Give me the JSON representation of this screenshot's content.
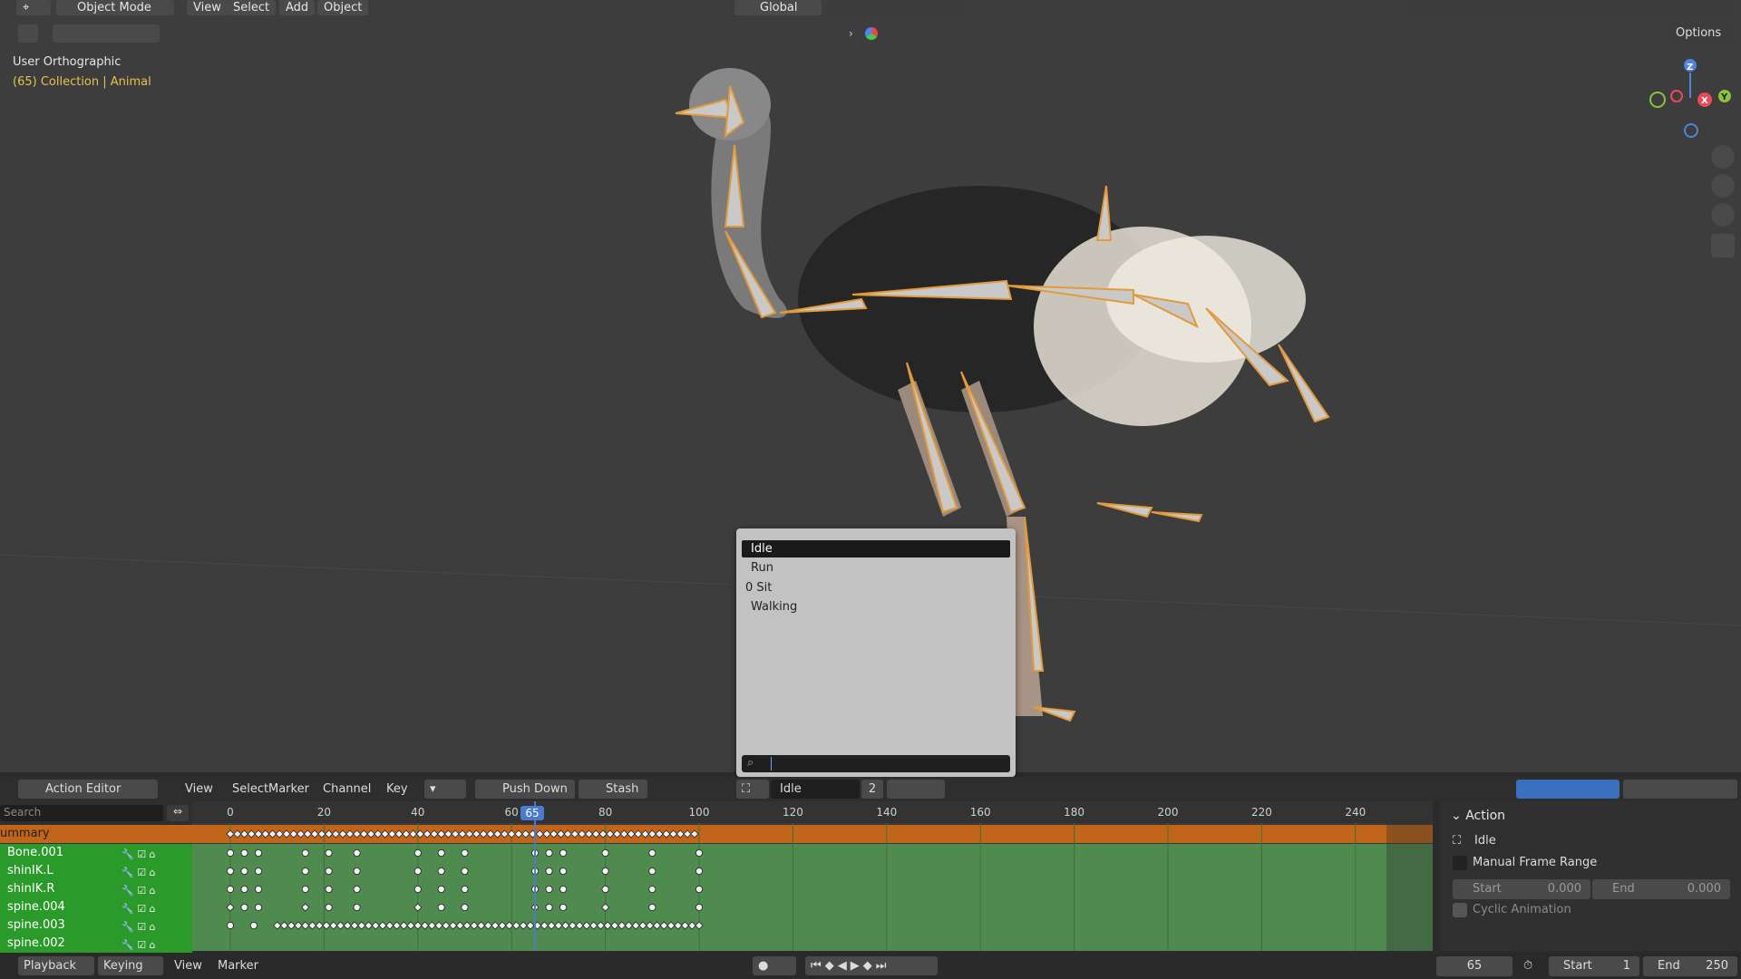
{
  "header": {
    "mode": "Object Mode",
    "menu": [
      "View",
      "Select",
      "Add",
      "Object"
    ],
    "orientation": "Global",
    "options": "Options"
  },
  "viewport": {
    "view_name": "User Orthographic",
    "collection_line": "(65) Collection | Animal"
  },
  "action_popup": {
    "items": [
      "Idle",
      "Run",
      "0 Sit",
      "Walking"
    ],
    "selected_index": 0,
    "search_value": ""
  },
  "action_editor": {
    "editor_type": "Action Editor",
    "menu": [
      "View",
      "Select",
      "Marker",
      "Channel",
      "Key"
    ],
    "push_down": "Push Down",
    "stash": "Stash",
    "action_name": "Idle",
    "users": "2",
    "search_placeholder": "Search",
    "ruler": [
      "0",
      "20",
      "40",
      "60",
      "80",
      "100",
      "120",
      "140",
      "160",
      "180",
      "200",
      "220",
      "240"
    ],
    "current_frame_label": "65",
    "channels": [
      "ummary",
      "Bone.001",
      "shinIK.L",
      "shinIK.R",
      "spine.004",
      "spine.003",
      "spine.002"
    ]
  },
  "properties": {
    "section": "Action",
    "action_name": "Idle",
    "manual_frame_range": "Manual Frame Range",
    "start_label": "Start",
    "start_value": "0.000",
    "end_label": "End",
    "end_value": "0.000",
    "cyclic": "Cyclic Animation"
  },
  "timeline": {
    "menu": [
      "Playback",
      "Keying",
      "View",
      "Marker"
    ],
    "current_frame": "65",
    "start_label": "Start",
    "start_value": "1",
    "end_label": "End",
    "end_value": "250"
  },
  "colors": {
    "summary_row": "#c0651a",
    "channel_green": "#2a9a2a",
    "dopesheet_green": "#4f8a4f",
    "playhead": "#4a7bd0",
    "selection": "#1a1a1a"
  }
}
